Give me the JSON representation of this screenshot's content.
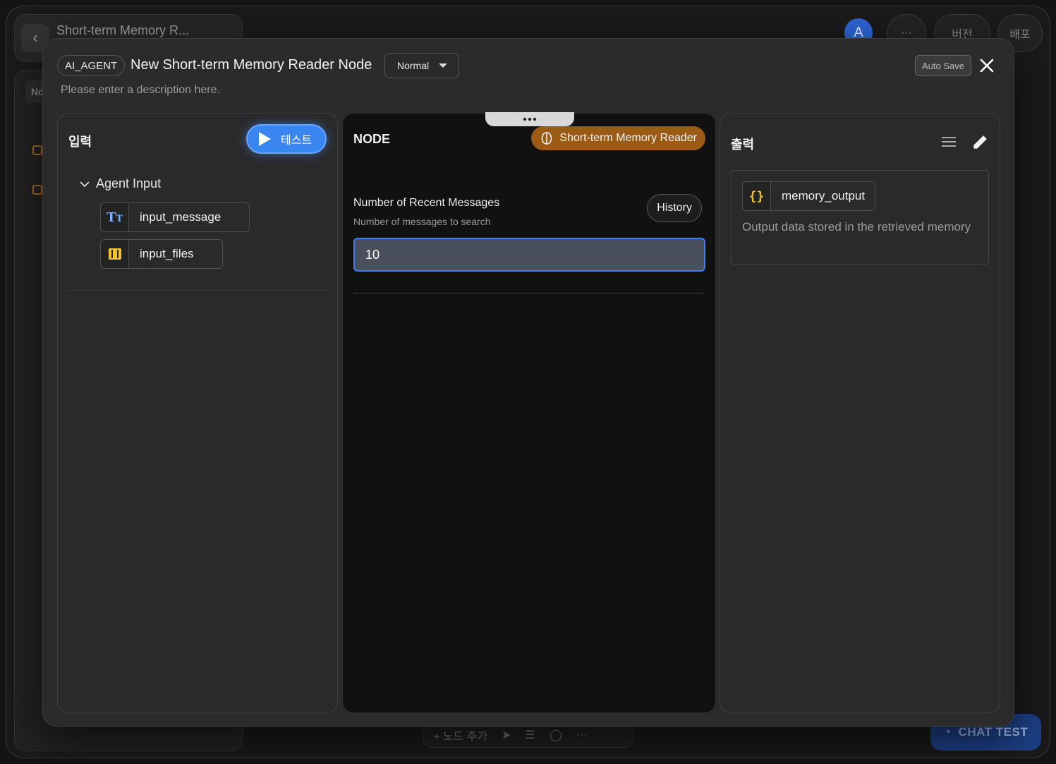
{
  "background": {
    "doc_title": "Short-term Memory R...",
    "left_tab": "No",
    "avatar_letter": "A",
    "more_label": "···",
    "version_label": "버전",
    "deploy_label": "배포",
    "toolbar_add_node": "+ 노드 추가",
    "chat_test_label": "CHAT TEST"
  },
  "modal": {
    "type_chip": "AI_AGENT",
    "title": "New Short-term Memory Reader Node",
    "mode": "Normal",
    "autosave_label": "Auto Save",
    "description_placeholder": "Please enter a description here."
  },
  "input_panel": {
    "title": "입력",
    "test_label": "테스트",
    "group_label": "Agent Input",
    "variables": [
      {
        "name": "input_message",
        "icon": "text-type-icon"
      },
      {
        "name": "input_files",
        "icon": "files-icon"
      }
    ]
  },
  "node_panel": {
    "title": "NODE",
    "badge_label": "Short-term Memory Reader",
    "field_label": "Number of Recent Messages",
    "field_help": "Number of messages to search",
    "history_label": "History",
    "field_value": "10"
  },
  "output_panel": {
    "title": "출력",
    "output_name": "memory_output",
    "output_desc": "Output data stored in the retrieved memory"
  },
  "colors": {
    "accent_blue": "#3a86f0",
    "badge_brown": "#9c5b14",
    "variable_yellow": "#f2c230"
  }
}
